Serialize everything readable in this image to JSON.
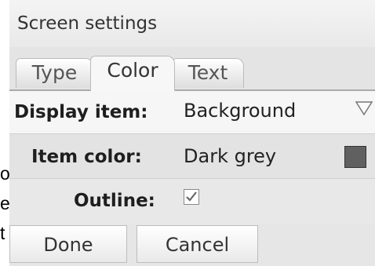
{
  "page_fragments": [
    "o",
    "e",
    "t"
  ],
  "dialog": {
    "title": "Screen settings",
    "tabs": [
      {
        "label": "Type"
      },
      {
        "label": "Color",
        "active": true
      },
      {
        "label": "Text"
      }
    ],
    "fields": {
      "display_item": {
        "label": "Display item:",
        "value": "Background",
        "icon": "triangle-down-icon"
      },
      "item_color": {
        "label": "Item color:",
        "value": "Dark grey",
        "swatch": "#606060"
      },
      "outline": {
        "label": "Outline:",
        "checked": true
      }
    },
    "buttons": {
      "done": "Done",
      "cancel": "Cancel"
    }
  }
}
